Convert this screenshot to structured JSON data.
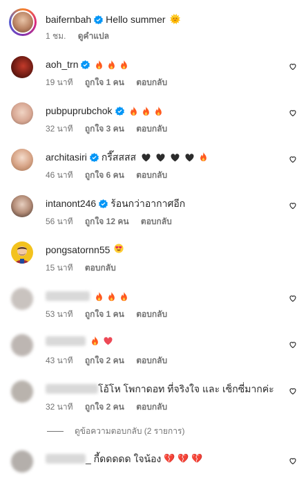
{
  "post": {
    "username": "baifernbah",
    "caption": "Hello summer",
    "caption_emoji": "🌞",
    "time": "1 ชม.",
    "translate": "ดูคำแปล"
  },
  "comments": [
    {
      "username": "aoh_trn",
      "verified": true,
      "text": "",
      "time": "19 นาที",
      "likes": "ถูกใจ 1 คน",
      "reply": "ตอบกลับ"
    },
    {
      "username": "pubpuprubchok",
      "verified": true,
      "text": "",
      "time": "32 นาที",
      "likes": "ถูกใจ 3 คน",
      "reply": "ตอบกลับ"
    },
    {
      "username": "architasiri",
      "verified": true,
      "text": "กรี๊สสสส",
      "time": "46 นาที",
      "likes": "ถูกใจ 6 คน",
      "reply": "ตอบกลับ"
    },
    {
      "username": "intanont246",
      "verified": true,
      "text": "ร้อนกว่าอากาศอีก",
      "time": "56 นาที",
      "likes": "ถูกใจ 12 คน",
      "reply": "ตอบกลับ"
    },
    {
      "username": "pongsatornn55",
      "verified": false,
      "text": "",
      "emoji": "😍",
      "time": "15 นาที",
      "likes": "",
      "reply": "ตอบกลับ"
    },
    {
      "username": "",
      "verified": false,
      "text": "",
      "time": "53 นาที",
      "likes": "ถูกใจ 1 คน",
      "reply": "ตอบกลับ"
    },
    {
      "username": "",
      "verified": false,
      "text": "",
      "time": "43 นาที",
      "likes": "ถูกใจ 2 คน",
      "reply": "ตอบกลับ"
    },
    {
      "username": "",
      "verified": false,
      "text": "โอ้โห โพกาดอท ที่จริงใจ และ เซ็กซี่มากค่ะ",
      "time": "32 นาที",
      "likes": "ถูกใจ 2 คน",
      "reply": "ตอบกลับ"
    },
    {
      "username": "",
      "verified": false,
      "text": "_ กี้ดดดดด ใจน้อง",
      "emoji": "💔 💔 💔",
      "time": "",
      "likes": "",
      "reply": ""
    }
  ],
  "view_replies": "ดูข้อความตอบกลับ (2 รายการ)",
  "colors": {
    "text": "#262626",
    "muted": "#737373",
    "verified": "#0095f6",
    "fire": "#ff5a1f",
    "heart": "#ed4956"
  }
}
